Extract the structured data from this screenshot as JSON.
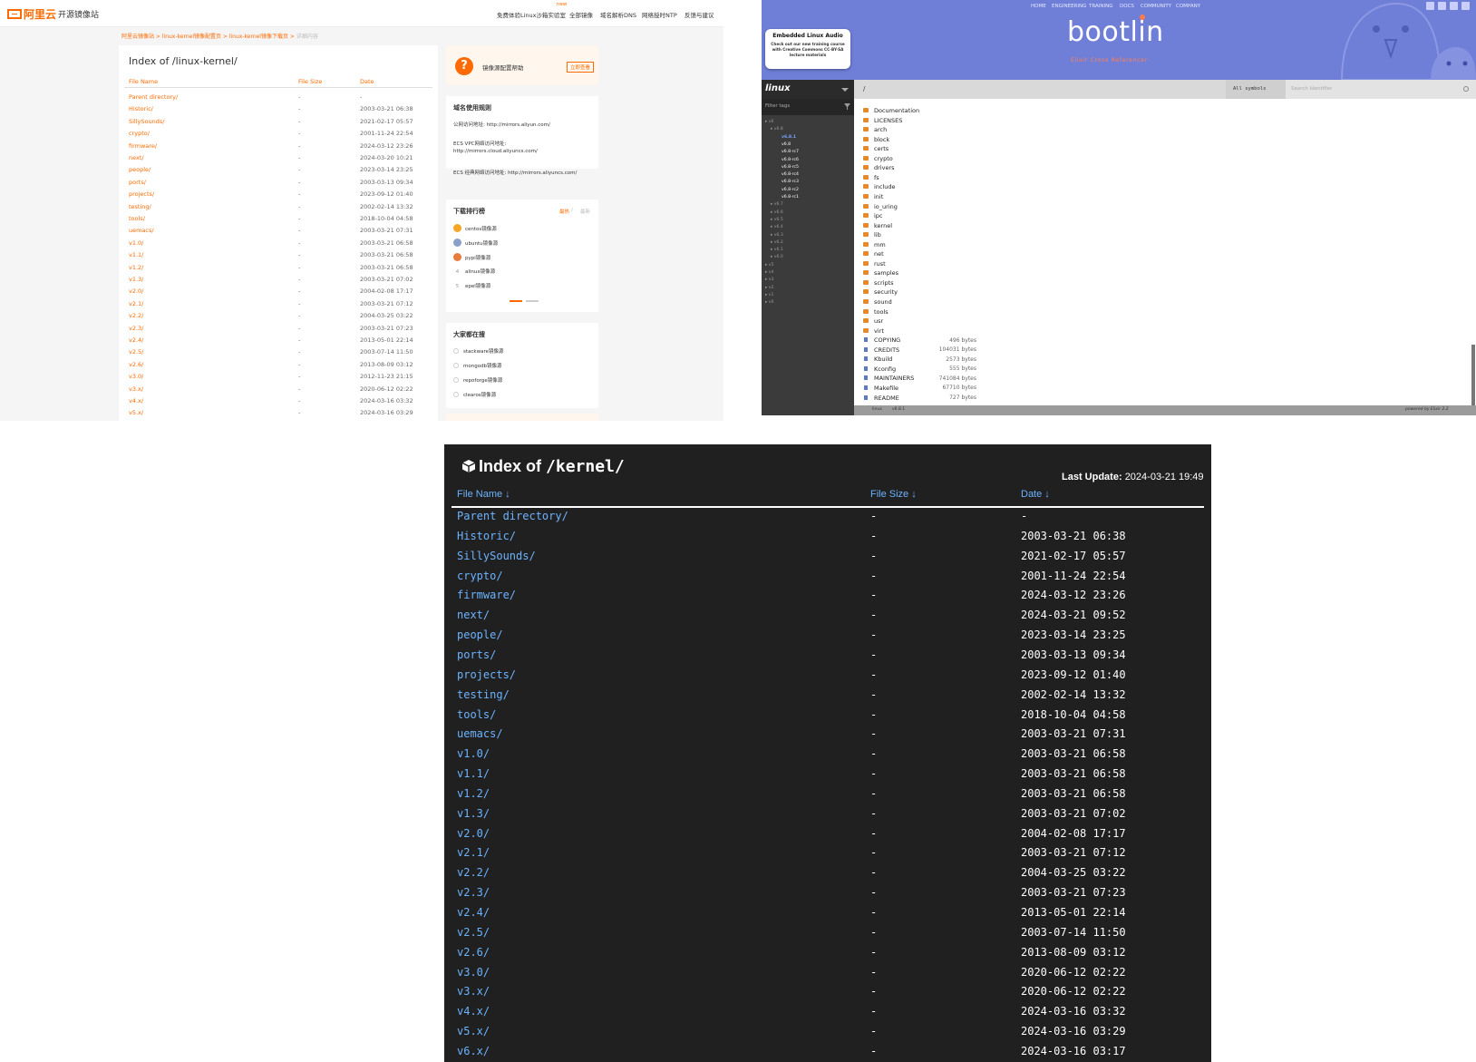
{
  "aliyun": {
    "logo": "阿里云",
    "site_title": "开源镜像站",
    "nav_new": "new",
    "nav": [
      "免费体验Linux沙箱实验室",
      "全部镜像",
      "域名解析DNS",
      "网络授时NTP",
      "反馈与建议"
    ],
    "breadcrumb": [
      "阿里云镜像站",
      "linux-kernel镜像配置页",
      "linux-kernel镜像下载页",
      "详细内容"
    ],
    "title": "Index of /linux-kernel/",
    "headers": {
      "name": "File Name",
      "size": "File Size",
      "date": "Date"
    },
    "rows": [
      {
        "name": "Parent directory/",
        "size": "-",
        "date": "-"
      },
      {
        "name": "Historic/",
        "size": "-",
        "date": "2003-03-21 06:38"
      },
      {
        "name": "SillySounds/",
        "size": "-",
        "date": "2021-02-17 05:57"
      },
      {
        "name": "crypto/",
        "size": "-",
        "date": "2001-11-24 22:54"
      },
      {
        "name": "firmware/",
        "size": "-",
        "date": "2024-03-12 23:26"
      },
      {
        "name": "next/",
        "size": "-",
        "date": "2024-03-20 10:21"
      },
      {
        "name": "people/",
        "size": "-",
        "date": "2023-03-14 23:25"
      },
      {
        "name": "ports/",
        "size": "-",
        "date": "2003-03-13 09:34"
      },
      {
        "name": "projects/",
        "size": "-",
        "date": "2023-09-12 01:40"
      },
      {
        "name": "testing/",
        "size": "-",
        "date": "2002-02-14 13:32"
      },
      {
        "name": "tools/",
        "size": "-",
        "date": "2018-10-04 04:58"
      },
      {
        "name": "uemacs/",
        "size": "-",
        "date": "2003-03-21 07:31"
      },
      {
        "name": "v1.0/",
        "size": "-",
        "date": "2003-03-21 06:58"
      },
      {
        "name": "v1.1/",
        "size": "-",
        "date": "2003-03-21 06:58"
      },
      {
        "name": "v1.2/",
        "size": "-",
        "date": "2003-03-21 06:58"
      },
      {
        "name": "v1.3/",
        "size": "-",
        "date": "2003-03-21 07:02"
      },
      {
        "name": "v2.0/",
        "size": "-",
        "date": "2004-02-08 17:17"
      },
      {
        "name": "v2.1/",
        "size": "-",
        "date": "2003-03-21 07:12"
      },
      {
        "name": "v2.2/",
        "size": "-",
        "date": "2004-03-25 03:22"
      },
      {
        "name": "v2.3/",
        "size": "-",
        "date": "2003-03-21 07:23"
      },
      {
        "name": "v2.4/",
        "size": "-",
        "date": "2013-05-01 22:14"
      },
      {
        "name": "v2.5/",
        "size": "-",
        "date": "2003-07-14 11:50"
      },
      {
        "name": "v2.6/",
        "size": "-",
        "date": "2013-08-09 03:12"
      },
      {
        "name": "v3.0/",
        "size": "-",
        "date": "2012-11-23 21:15"
      },
      {
        "name": "v3.x/",
        "size": "-",
        "date": "2020-06-12 02:22"
      },
      {
        "name": "v4.x/",
        "size": "-",
        "date": "2024-03-16 03:32"
      },
      {
        "name": "v5.x/",
        "size": "-",
        "date": "2024-03-16 03:29"
      }
    ],
    "help": {
      "title": "镜像源配置帮助",
      "button": "立即查看"
    },
    "domain": {
      "title": "域名使用规则",
      "public": "公网访问地址: http://mirrors.aliyun.com/",
      "vpc_label": "ECS VPC网络访问地址:",
      "vpc_url": "http://mirrors.cloud.aliyuncs.com/",
      "classic": "ECS 经典网络访问地址: http://mirrors.aliyuncs.com/"
    },
    "ranking": {
      "title": "下载排行榜",
      "tab_hot": "最热",
      "tab_new": "最新",
      "items": [
        {
          "rank": "1",
          "name": "centos镜像源",
          "color": "#f5a623"
        },
        {
          "rank": "2",
          "name": "ubuntu镜像源",
          "color": "#8aa0c8"
        },
        {
          "rank": "3",
          "name": "pypi镜像源",
          "color": "#e87b3e"
        },
        {
          "rank": "4",
          "name": "alinux镜像源"
        },
        {
          "rank": "5",
          "name": "epel镜像源"
        }
      ]
    },
    "searching": {
      "title": "大家都在搜",
      "items": [
        "stackware镜像源",
        "mongodb镜像源",
        "repoforge镜像源",
        "clearos镜像源"
      ]
    }
  },
  "bootlin": {
    "top_nav": [
      "HOME",
      "ENGINEERING",
      "TRAINING",
      "DOCS",
      "COMMUNITY",
      "COMPANY"
    ],
    "brand": "bootlin",
    "subtitle": "Elixir Cross Referencer",
    "ad_title": "Embedded Linux Audio",
    "ad_text": "Check out our new training course with Creative Commons CC-BY-SA lecture materials",
    "project": "linux",
    "path": "/",
    "symbols": "All symbols",
    "search_placeholder": "Search Identifier",
    "filter_placeholder": "Filter tags",
    "tree": [
      {
        "label": "v6",
        "level": 0
      },
      {
        "label": "v6.8",
        "level": 1
      },
      {
        "label": "v6.8.1",
        "level": 2,
        "active": true
      },
      {
        "label": "v6.8",
        "level": 2
      },
      {
        "label": "v6.8-rc7",
        "level": 2
      },
      {
        "label": "v6.8-rc6",
        "level": 2
      },
      {
        "label": "v6.8-rc5",
        "level": 2
      },
      {
        "label": "v6.8-rc4",
        "level": 2
      },
      {
        "label": "v6.8-rc3",
        "level": 2
      },
      {
        "label": "v6.8-rc2",
        "level": 2
      },
      {
        "label": "v6.8-rc1",
        "level": 2
      },
      {
        "label": "v6.7",
        "level": 1
      },
      {
        "label": "v6.6",
        "level": 1
      },
      {
        "label": "v6.5",
        "level": 1
      },
      {
        "label": "v6.4",
        "level": 1
      },
      {
        "label": "v6.3",
        "level": 1
      },
      {
        "label": "v6.2",
        "level": 1
      },
      {
        "label": "v6.1",
        "level": 1
      },
      {
        "label": "v6.0",
        "level": 1
      },
      {
        "label": "v5",
        "level": 0
      },
      {
        "label": "v4",
        "level": 0
      },
      {
        "label": "v3",
        "level": 0
      },
      {
        "label": "v2",
        "level": 0
      },
      {
        "label": "v1",
        "level": 0
      },
      {
        "label": "v0",
        "level": 0
      }
    ],
    "entries": [
      {
        "name": "Documentation",
        "type": "dir"
      },
      {
        "name": "LICENSES",
        "type": "dir"
      },
      {
        "name": "arch",
        "type": "dir"
      },
      {
        "name": "block",
        "type": "dir"
      },
      {
        "name": "certs",
        "type": "dir"
      },
      {
        "name": "crypto",
        "type": "dir"
      },
      {
        "name": "drivers",
        "type": "dir"
      },
      {
        "name": "fs",
        "type": "dir"
      },
      {
        "name": "include",
        "type": "dir"
      },
      {
        "name": "init",
        "type": "dir"
      },
      {
        "name": "io_uring",
        "type": "dir"
      },
      {
        "name": "ipc",
        "type": "dir"
      },
      {
        "name": "kernel",
        "type": "dir"
      },
      {
        "name": "lib",
        "type": "dir"
      },
      {
        "name": "mm",
        "type": "dir"
      },
      {
        "name": "net",
        "type": "dir"
      },
      {
        "name": "rust",
        "type": "dir"
      },
      {
        "name": "samples",
        "type": "dir"
      },
      {
        "name": "scripts",
        "type": "dir"
      },
      {
        "name": "security",
        "type": "dir"
      },
      {
        "name": "sound",
        "type": "dir"
      },
      {
        "name": "tools",
        "type": "dir"
      },
      {
        "name": "usr",
        "type": "dir"
      },
      {
        "name": "virt",
        "type": "dir"
      },
      {
        "name": "COPYING",
        "type": "file",
        "size": "496 bytes"
      },
      {
        "name": "CREDITS",
        "type": "file",
        "size": "104031 bytes"
      },
      {
        "name": "Kbuild",
        "type": "file",
        "size": "2573 bytes"
      },
      {
        "name": "Kconfig",
        "type": "file",
        "size": "555 bytes"
      },
      {
        "name": "MAINTAINERS",
        "type": "file",
        "size": "741084 bytes"
      },
      {
        "name": "Makefile",
        "type": "file",
        "size": "67710 bytes"
      },
      {
        "name": "README",
        "type": "file",
        "size": "727 bytes"
      }
    ],
    "footer_left": "linux",
    "footer_version": "v6.8.1",
    "footer_right": "powered by Elixir 2.2"
  },
  "kernel": {
    "title_prefix": "Index of",
    "title_path": "/kernel/",
    "last_update_label": "Last Update:",
    "last_update_value": "2024-03-21 19:49",
    "headers": {
      "name": "File Name ↓",
      "size": "File Size ↓",
      "date": "Date ↓"
    },
    "rows": [
      {
        "name": "Parent directory/",
        "size": "-",
        "date": "-"
      },
      {
        "name": "Historic/",
        "size": "-",
        "date": "2003-03-21 06:38"
      },
      {
        "name": "SillySounds/",
        "size": "-",
        "date": "2021-02-17 05:57"
      },
      {
        "name": "crypto/",
        "size": "-",
        "date": "2001-11-24 22:54"
      },
      {
        "name": "firmware/",
        "size": "-",
        "date": "2024-03-12 23:26"
      },
      {
        "name": "next/",
        "size": "-",
        "date": "2024-03-21 09:52"
      },
      {
        "name": "people/",
        "size": "-",
        "date": "2023-03-14 23:25"
      },
      {
        "name": "ports/",
        "size": "-",
        "date": "2003-03-13 09:34"
      },
      {
        "name": "projects/",
        "size": "-",
        "date": "2023-09-12 01:40"
      },
      {
        "name": "testing/",
        "size": "-",
        "date": "2002-02-14 13:32"
      },
      {
        "name": "tools/",
        "size": "-",
        "date": "2018-10-04 04:58"
      },
      {
        "name": "uemacs/",
        "size": "-",
        "date": "2003-03-21 07:31"
      },
      {
        "name": "v1.0/",
        "size": "-",
        "date": "2003-03-21 06:58"
      },
      {
        "name": "v1.1/",
        "size": "-",
        "date": "2003-03-21 06:58"
      },
      {
        "name": "v1.2/",
        "size": "-",
        "date": "2003-03-21 06:58"
      },
      {
        "name": "v1.3/",
        "size": "-",
        "date": "2003-03-21 07:02"
      },
      {
        "name": "v2.0/",
        "size": "-",
        "date": "2004-02-08 17:17"
      },
      {
        "name": "v2.1/",
        "size": "-",
        "date": "2003-03-21 07:12"
      },
      {
        "name": "v2.2/",
        "size": "-",
        "date": "2004-03-25 03:22"
      },
      {
        "name": "v2.3/",
        "size": "-",
        "date": "2003-03-21 07:23"
      },
      {
        "name": "v2.4/",
        "size": "-",
        "date": "2013-05-01 22:14"
      },
      {
        "name": "v2.5/",
        "size": "-",
        "date": "2003-07-14 11:50"
      },
      {
        "name": "v2.6/",
        "size": "-",
        "date": "2013-08-09 03:12"
      },
      {
        "name": "v3.0/",
        "size": "-",
        "date": "2020-06-12 02:22"
      },
      {
        "name": "v3.x/",
        "size": "-",
        "date": "2020-06-12 02:22"
      },
      {
        "name": "v4.x/",
        "size": "-",
        "date": "2024-03-16 03:32"
      },
      {
        "name": "v5.x/",
        "size": "-",
        "date": "2024-03-16 03:29"
      },
      {
        "name": "v6.x/",
        "size": "-",
        "date": "2024-03-16 03:17"
      }
    ]
  }
}
